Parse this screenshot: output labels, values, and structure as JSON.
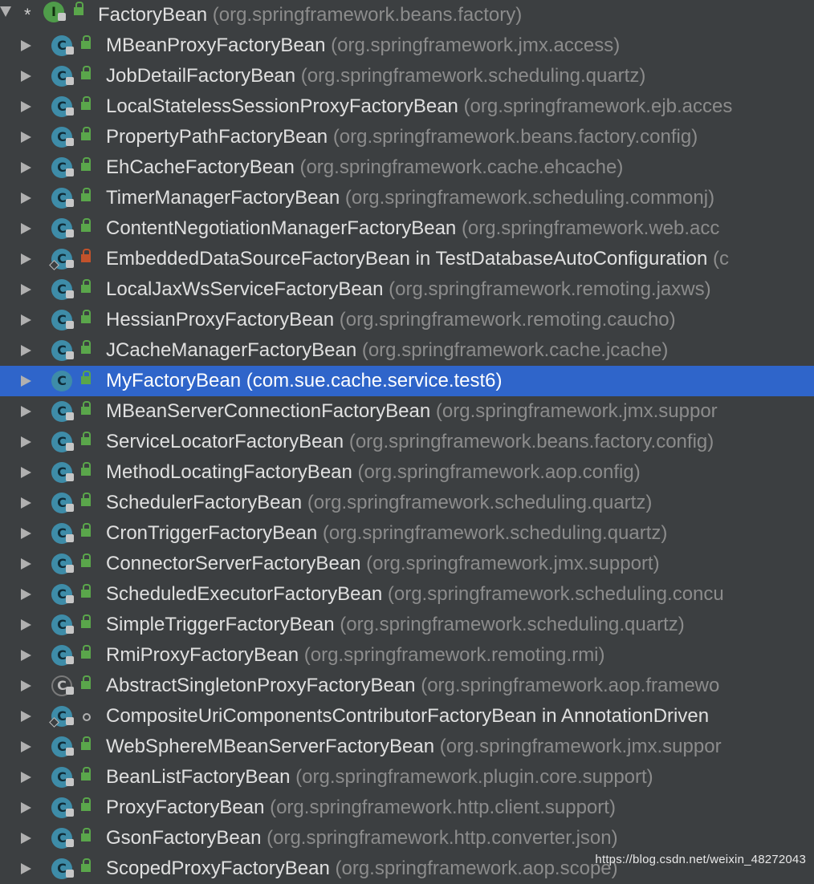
{
  "root": {
    "marker": "*",
    "icon_letter": "I",
    "name": "FactoryBean",
    "package": "(org.springframework.beans.factory)"
  },
  "items": [
    {
      "name": "MBeanProxyFactoryBean",
      "package": "(org.springframework.jmx.access)",
      "icon": "C",
      "visibility": "public"
    },
    {
      "name": "JobDetailFactoryBean",
      "package": "(org.springframework.scheduling.quartz)",
      "icon": "C",
      "visibility": "public"
    },
    {
      "name": "LocalStatelessSessionProxyFactoryBean",
      "package": "(org.springframework.ejb.acces",
      "icon": "C",
      "visibility": "public"
    },
    {
      "name": "PropertyPathFactoryBean",
      "package": "(org.springframework.beans.factory.config)",
      "icon": "C",
      "visibility": "public"
    },
    {
      "name": "EhCacheFactoryBean",
      "package": "(org.springframework.cache.ehcache)",
      "icon": "C",
      "visibility": "public"
    },
    {
      "name": "TimerManagerFactoryBean",
      "package": "(org.springframework.scheduling.commonj)",
      "icon": "C",
      "visibility": "public"
    },
    {
      "name": "ContentNegotiationManagerFactoryBean",
      "package": "(org.springframework.web.acc",
      "icon": "C",
      "visibility": "public"
    },
    {
      "name": "EmbeddedDataSourceFactoryBean in TestDatabaseAutoConfiguration",
      "package": "(c",
      "icon": "C",
      "visibility": "private",
      "inner": true
    },
    {
      "name": "LocalJaxWsServiceFactoryBean",
      "package": "(org.springframework.remoting.jaxws)",
      "icon": "C",
      "visibility": "public"
    },
    {
      "name": "HessianProxyFactoryBean",
      "package": "(org.springframework.remoting.caucho)",
      "icon": "C",
      "visibility": "public"
    },
    {
      "name": "JCacheManagerFactoryBean",
      "package": "(org.springframework.cache.jcache)",
      "icon": "C",
      "visibility": "public"
    },
    {
      "name": "MyFactoryBean",
      "package": "(com.sue.cache.service.test6)",
      "icon": "C",
      "visibility": "public",
      "selected": true
    },
    {
      "name": "MBeanServerConnectionFactoryBean",
      "package": "(org.springframework.jmx.suppor",
      "icon": "C",
      "visibility": "public"
    },
    {
      "name": "ServiceLocatorFactoryBean",
      "package": "(org.springframework.beans.factory.config)",
      "icon": "C",
      "visibility": "public"
    },
    {
      "name": "MethodLocatingFactoryBean",
      "package": "(org.springframework.aop.config)",
      "icon": "C",
      "visibility": "public"
    },
    {
      "name": "SchedulerFactoryBean",
      "package": "(org.springframework.scheduling.quartz)",
      "icon": "C",
      "visibility": "public"
    },
    {
      "name": "CronTriggerFactoryBean",
      "package": "(org.springframework.scheduling.quartz)",
      "icon": "C",
      "visibility": "public"
    },
    {
      "name": "ConnectorServerFactoryBean",
      "package": "(org.springframework.jmx.support)",
      "icon": "C",
      "visibility": "public"
    },
    {
      "name": "ScheduledExecutorFactoryBean",
      "package": "(org.springframework.scheduling.concu",
      "icon": "C",
      "visibility": "public"
    },
    {
      "name": "SimpleTriggerFactoryBean",
      "package": "(org.springframework.scheduling.quartz)",
      "icon": "C",
      "visibility": "public"
    },
    {
      "name": "RmiProxyFactoryBean",
      "package": "(org.springframework.remoting.rmi)",
      "icon": "C",
      "visibility": "public"
    },
    {
      "name": "AbstractSingletonProxyFactoryBean",
      "package": "(org.springframework.aop.framewo",
      "icon": "C",
      "visibility": "public",
      "abstract": true
    },
    {
      "name": "CompositeUriComponentsContributorFactoryBean in AnnotationDriven",
      "package": "",
      "icon": "C",
      "visibility": "package",
      "inner": true
    },
    {
      "name": "WebSphereMBeanServerFactoryBean",
      "package": "(org.springframework.jmx.suppor",
      "icon": "C",
      "visibility": "public"
    },
    {
      "name": "BeanListFactoryBean",
      "package": "(org.springframework.plugin.core.support)",
      "icon": "C",
      "visibility": "public"
    },
    {
      "name": "ProxyFactoryBean",
      "package": "(org.springframework.http.client.support)",
      "icon": "C",
      "visibility": "public"
    },
    {
      "name": "GsonFactoryBean",
      "package": "(org.springframework.http.converter.json)",
      "icon": "C",
      "visibility": "public"
    },
    {
      "name": "ScopedProxyFactoryBean",
      "package": "(org.springframework.aop.scope)",
      "icon": "C",
      "visibility": "public"
    }
  ],
  "watermark": "https://blog.csdn.net/weixin_48272043",
  "colors": {
    "background": "#3c3f41",
    "selection": "#2f65ca",
    "class_icon": "#3e8ca8",
    "interface_icon": "#4f9c4a",
    "public_lock": "#5aa64b",
    "private_lock": "#c2522b"
  }
}
